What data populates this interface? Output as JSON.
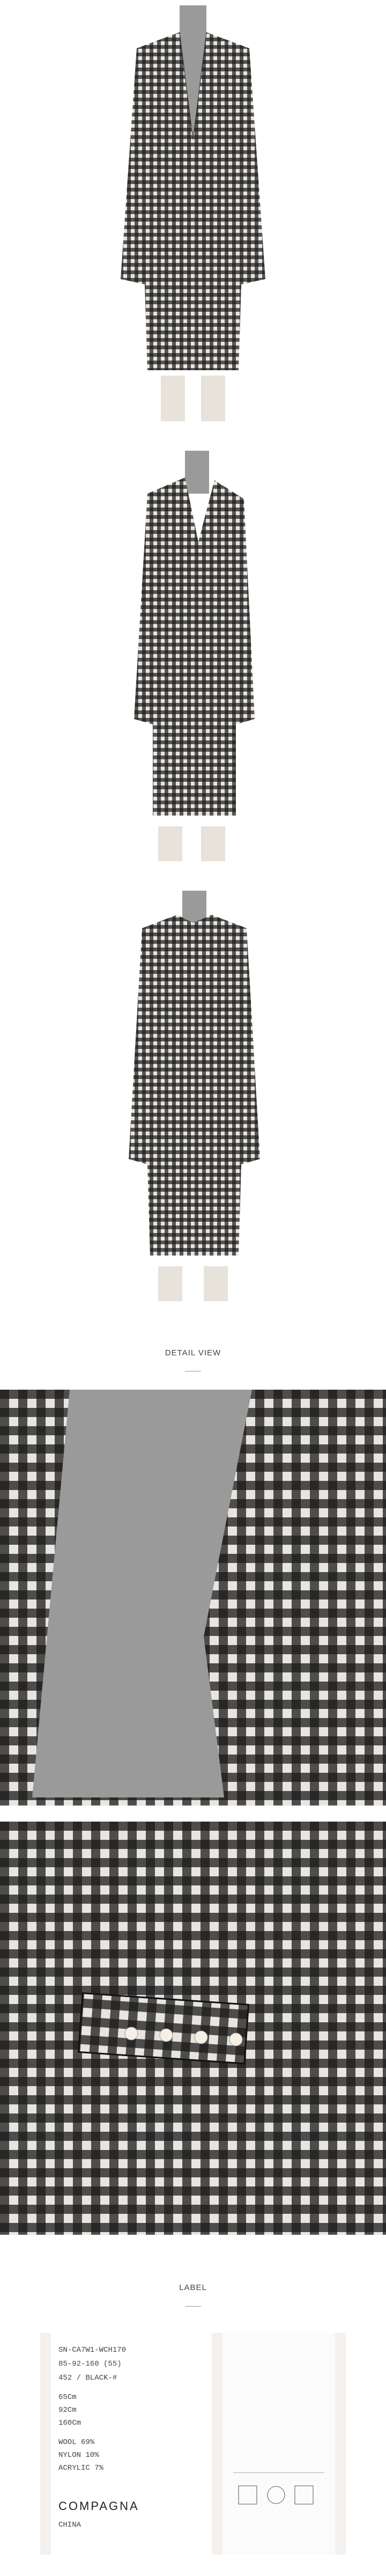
{
  "sections": {
    "detail_view_title": "DETAIL VIEW",
    "label_title": "LABEL"
  },
  "photos": {
    "front_full": "model-front-coat-photo",
    "side_full": "model-side-coat-photo",
    "back_full": "model-back-coat-photo",
    "detail_collar": "collar-detail-photo",
    "detail_pocket": "pocket-pearl-detail-photo",
    "label": "care-label-photo"
  },
  "label_tag": {
    "lines": [
      "SN-CA7W1-WCH170",
      "85-92-160 (55)",
      "452 / BLACK-#",
      "65Cm",
      "92Cm",
      "160Cm",
      "WOOL 69%",
      "NYLON 10%",
      "ACRYLIC 7%"
    ],
    "brand": "COMPAGNA",
    "origin": "CHINA"
  },
  "colors": {
    "check_dark": "#1a1a1a",
    "check_light": "#e8e4df",
    "sweater": "#9a9a9a",
    "background": "#ffffff"
  }
}
